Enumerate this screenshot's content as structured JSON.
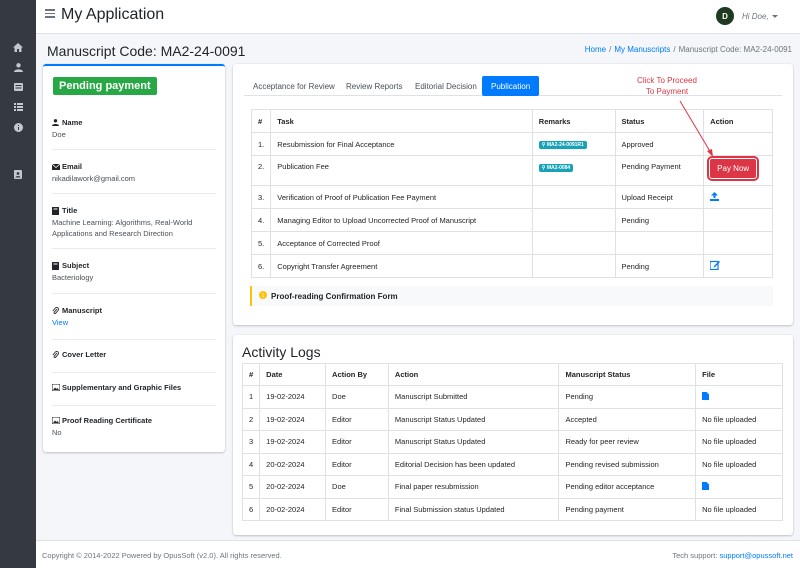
{
  "app": {
    "title": "My Application",
    "avatar_initial": "D",
    "greeting": "Hi Doe,"
  },
  "page": {
    "title": "Manuscript Code: MA2-24-0091"
  },
  "breadcrumb": {
    "home": "Home",
    "manuscripts": "My Manuscripts",
    "current": "Manuscript Code: MA2-24-0091"
  },
  "sidebar": {
    "icons": [
      "home-icon",
      "user-icon",
      "list-icon",
      "list-alt-icon",
      "info-icon",
      "id-card-icon"
    ]
  },
  "status_badge": "Pending payment",
  "details": {
    "name_label": "Name",
    "name_value": "Doe",
    "email_label": "Email",
    "email_value": "nikadilawork@gmail.com",
    "title_label": "Title",
    "title_value": "Machine Learning: Algorithms, Real-World Applications and Research Direction",
    "subject_label": "Subject",
    "subject_value": "Bacteriology",
    "manuscript_label": "Manuscript",
    "manuscript_link": "View",
    "cover_label": "Cover Letter",
    "supp_label": "Supplementary and Graphic Files",
    "proof_label": "Proof Reading Certificate",
    "proof_value": "No"
  },
  "tabs": [
    "Acceptance for Review",
    "Review Reports",
    "Editorial Decision",
    "Publication"
  ],
  "tasks": {
    "headers": [
      "#",
      "Task",
      "Remarks",
      "Status",
      "Action"
    ],
    "rows": [
      {
        "num": "1.",
        "task": "Resubmission for Final Acceptance",
        "remark": "MA2-24-0091R1",
        "status": "Approved",
        "action": ""
      },
      {
        "num": "2.",
        "task": "Publication Fee",
        "remark": "MA2-0084",
        "status": "Pending Payment",
        "action": "Pay Now"
      },
      {
        "num": "3.",
        "task": "Verification of Proof of Publication Fee Payment",
        "remark": "",
        "status": "Upload Receipt",
        "action": "upload-icon"
      },
      {
        "num": "4.",
        "task": "Managing Editor to Upload Uncorrected Proof of Manuscript",
        "remark": "",
        "status": "Pending",
        "action": ""
      },
      {
        "num": "5.",
        "task": "Acceptance of Corrected Proof",
        "remark": "",
        "status": "",
        "action": ""
      },
      {
        "num": "6.",
        "task": "Copyright Transfer Agreement",
        "remark": "",
        "status": "Pending",
        "action": "edit-icon"
      }
    ]
  },
  "proof_form": "Proof-reading Confirmation Form",
  "annotation": {
    "line1": "Click To Proceed",
    "line2": "To Payment"
  },
  "activity": {
    "title": "Activity Logs",
    "headers": [
      "#",
      "Date",
      "Action By",
      "Action",
      "Manuscript Status",
      "File"
    ],
    "rows": [
      {
        "num": "1",
        "date": "19-02-2024",
        "by": "Doe",
        "action": "Manuscript Submitted",
        "status": "Pending",
        "file": "file-icon"
      },
      {
        "num": "2",
        "date": "19-02-2024",
        "by": "Editor",
        "action": "Manuscript Status Updated",
        "status": "Accepted",
        "file": "No file uploaded"
      },
      {
        "num": "3",
        "date": "19-02-2024",
        "by": "Editor",
        "action": "Manuscript Status Updated",
        "status": "Ready for peer review",
        "file": "No file uploaded"
      },
      {
        "num": "4",
        "date": "20-02-2024",
        "by": "Editor",
        "action": "Editorial Decision has been updated",
        "status": "Pending revised submission",
        "file": "No file uploaded"
      },
      {
        "num": "5",
        "date": "20-02-2024",
        "by": "Doe",
        "action": "Final paper resubmission",
        "status": "Pending editor acceptance",
        "file": "file-icon"
      },
      {
        "num": "6",
        "date": "20-02-2024",
        "by": "Editor",
        "action": "Final Submission status Updated",
        "status": "Pending payment",
        "file": "No file uploaded"
      }
    ]
  },
  "footer": {
    "copyright": "Copyright © 2014-2022 Powered by OpusSoft (v2.0). All rights reserved.",
    "support_label": "Tech support:",
    "support_email": "support@opussoft.net"
  },
  "colors": {
    "primary": "#007bff",
    "success": "#28a745",
    "danger": "#dc3545",
    "info": "#17a2b8",
    "sidebar": "#343a40"
  }
}
